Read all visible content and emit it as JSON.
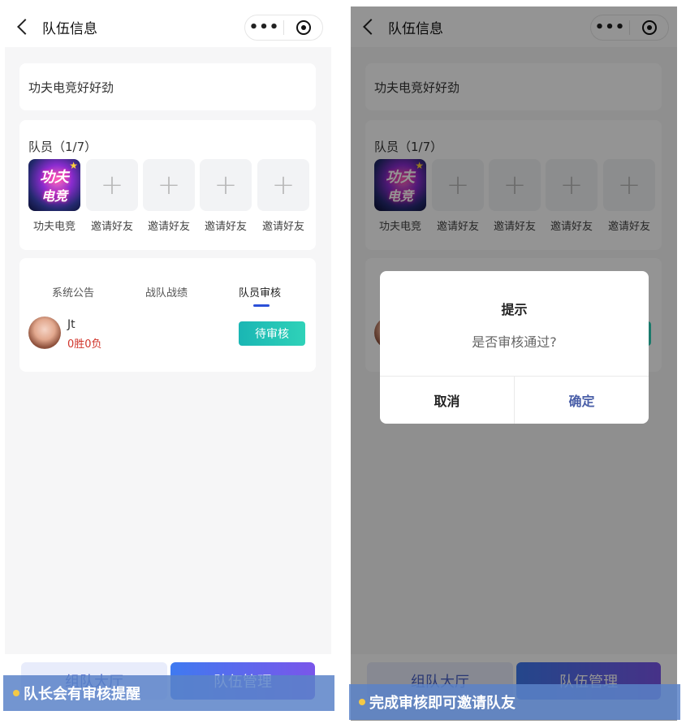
{
  "nav": {
    "title": "队伍信息",
    "more_glyph": "•••"
  },
  "team": {
    "name": "功夫电竞好好劲"
  },
  "members": {
    "title": "队员（1/7）",
    "leader": {
      "name": "功夫电竞",
      "logo_line1": "功夫",
      "logo_line2": "电竞"
    },
    "plus_glyph": "+",
    "invite_label": "邀请好友",
    "invite_slots": [
      "邀请好友",
      "邀请好友",
      "邀请好友",
      "邀请好友"
    ]
  },
  "tabs": [
    {
      "label": "系统公告"
    },
    {
      "label": "战队战绩"
    },
    {
      "label": "队员审核"
    }
  ],
  "applicant": {
    "name": "Jt",
    "record": "0胜0负",
    "status_button": "待审核"
  },
  "bottom": {
    "lobby": "组队大厅",
    "manage": "队伍管理"
  },
  "captions": {
    "left": "队长会有审核提醒",
    "right": "完成审核即可邀请队友"
  },
  "dialog": {
    "title": "提示",
    "message": "是否审核通过?",
    "cancel": "取消",
    "confirm": "确定"
  },
  "colors": {
    "accent": "#2b50d8",
    "review_button": "#1ab6b4",
    "record_red": "#d0352b",
    "caption_dot": "#f4c945"
  }
}
